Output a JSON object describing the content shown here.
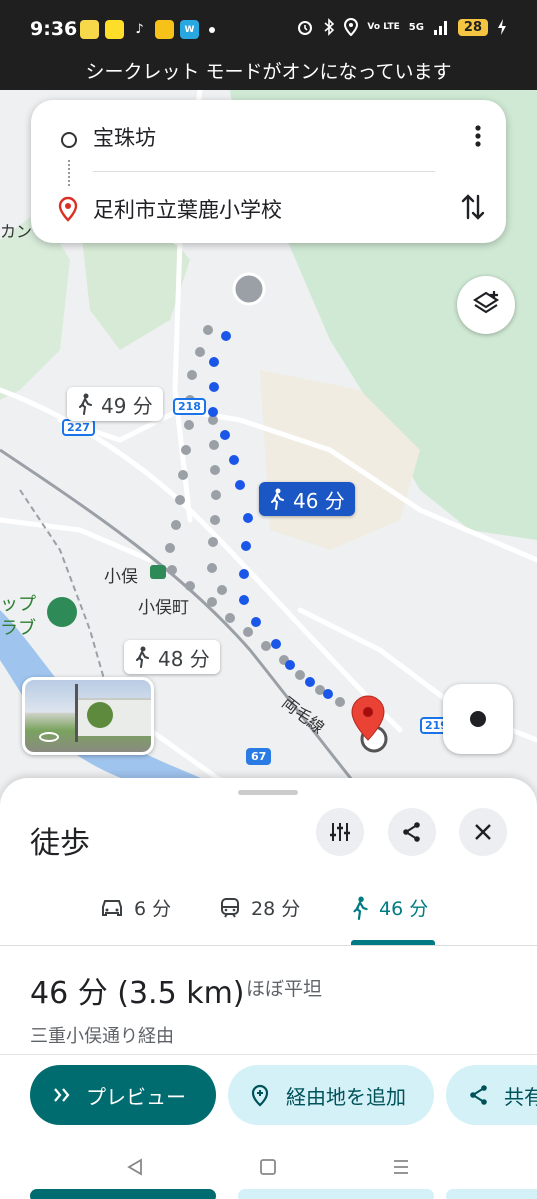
{
  "status_bar": {
    "time": "9:36",
    "notification_icons": [
      "app-icon-1",
      "app-icon-2",
      "tiktok-icon",
      "app-icon-4",
      "w-app-icon"
    ],
    "battery": "28",
    "network": "5G",
    "volte": "Vo LTE"
  },
  "incognito_banner": "シークレット モードがオンになっています",
  "search": {
    "origin": "宝珠坊",
    "destination": "足利市立葉鹿小学校"
  },
  "map": {
    "chips": {
      "alt_route_1": "49 分",
      "selected_route": "46 分",
      "alt_route_2": "48 分"
    },
    "labels": {
      "station": "小俣",
      "town": "小俣町",
      "rail_line": "両毛線",
      "edge_top": "カン",
      "edge_left_1": "ップ",
      "edge_left_2": "ラブ"
    },
    "road_shields": {
      "r218": "218",
      "r227": "227",
      "r67": "67",
      "r219": "219"
    },
    "colors": {
      "route_selected": "#1a56c4",
      "route_alt": "#9aa0a6",
      "destination_pin": "#ea4335"
    }
  },
  "sheet": {
    "title": "徒歩",
    "tabs": [
      {
        "label": "6 分",
        "icon": "car-icon"
      },
      {
        "label": "28 分",
        "icon": "train-icon"
      },
      {
        "label": "46 分",
        "icon": "walk-icon"
      }
    ],
    "active_tab": 2,
    "summary": {
      "duration_distance": "46 分 (3.5 km)",
      "terrain": "ほぼ平坦",
      "via": "三重小俣通り経由"
    },
    "buttons": {
      "preview": "プレビュー",
      "add_stop": "経由地を追加",
      "share": "共有"
    },
    "accent": "#007b83"
  }
}
